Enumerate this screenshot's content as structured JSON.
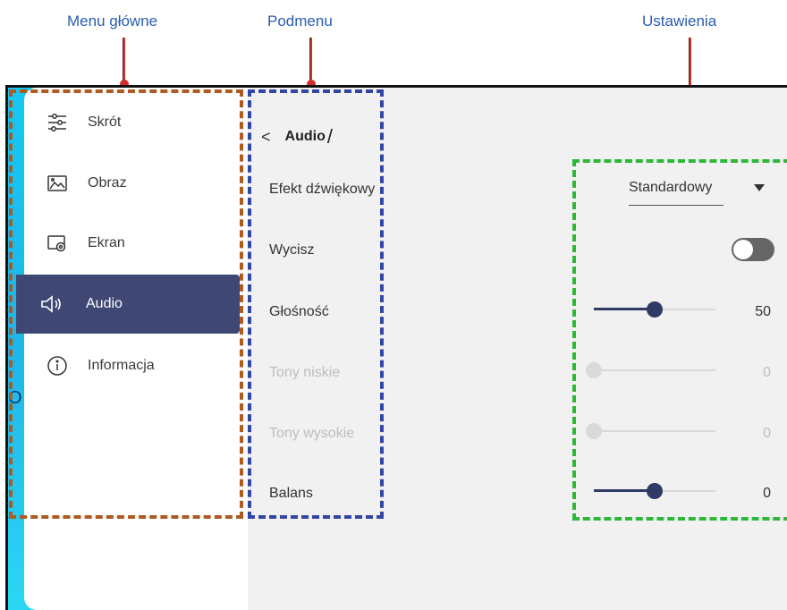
{
  "annotations": {
    "main_menu": "Menu główne",
    "submenu": "Podmenu",
    "settings": "Ustawienia"
  },
  "main_menu": {
    "items": [
      {
        "label": "Skrót",
        "icon": "sliders-icon"
      },
      {
        "label": "Obraz",
        "icon": "image-icon"
      },
      {
        "label": "Ekran",
        "icon": "screen-settings-icon"
      },
      {
        "label": "Audio",
        "icon": "speaker-icon",
        "active": true
      },
      {
        "label": "Informacja",
        "icon": "info-icon"
      }
    ]
  },
  "submenu": {
    "back_glyph": "<",
    "title": "Audio",
    "title_suffix": "/",
    "items": [
      {
        "label": "Efekt dźwiękowy",
        "enabled": true
      },
      {
        "label": "Wycisz",
        "enabled": true
      },
      {
        "label": "Głośność",
        "enabled": true
      },
      {
        "label": "Tony niskie",
        "enabled": false
      },
      {
        "label": "Tony wysokie",
        "enabled": false
      },
      {
        "label": "Balans",
        "enabled": true
      }
    ]
  },
  "settings": {
    "sound_effect": {
      "selected": "Standardowy"
    },
    "mute": {
      "on": false
    },
    "volume": {
      "value": "50",
      "fraction": 0.5
    },
    "bass": {
      "value": "0",
      "fraction": 0.0
    },
    "treble": {
      "value": "0",
      "fraction": 0.0
    },
    "balance": {
      "value": "0",
      "fraction": 0.5
    }
  },
  "colors": {
    "active_item_bg": "#3f4875",
    "slider_active": "#2f3a66",
    "annotation_text": "#2a5db0",
    "main_menu_box": "#b05a20",
    "submenu_box": "#3246a8",
    "settings_box": "#2eb83a"
  }
}
